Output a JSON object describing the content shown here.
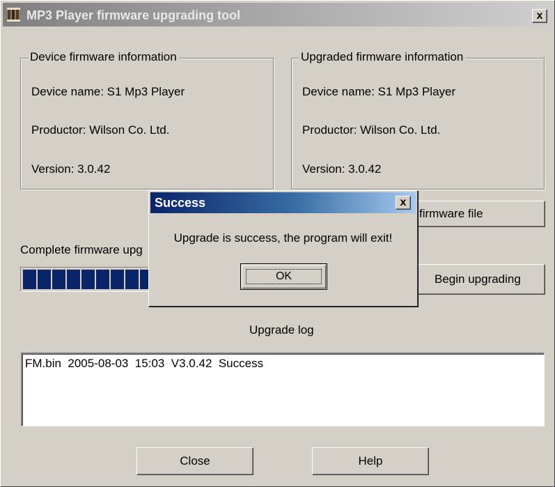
{
  "window": {
    "title": "MP3 Player firmware upgrading tool",
    "close_symbol": "x"
  },
  "device_group": {
    "title": "Device firmware information",
    "device_name": "Device name: S1 Mp3 Player",
    "productor": "Productor: Wilson Co. Ltd.",
    "version": "Version: 3.0.42"
  },
  "upgraded_group": {
    "title": "Upgraded firmware information",
    "device_name": "Device name: S1 Mp3 Player",
    "productor": "Productor: Wilson Co. Ltd.",
    "version": "Version: 3.0.42"
  },
  "buttons": {
    "select_file": "firmware file",
    "begin_upgrading": "Begin upgrading",
    "close": "Close",
    "help": "Help"
  },
  "progress": {
    "label": "Complete firmware upg",
    "filled_segments": 9,
    "color": "#0a246a"
  },
  "log": {
    "title": "Upgrade log",
    "entries": [
      "FM.bin  2005-08-03  15:03  V3.0.42  Success"
    ]
  },
  "dialog": {
    "title": "Success",
    "close_symbol": "x",
    "message": "Upgrade is success, the program will exit!",
    "ok_label": "OK"
  },
  "icons": {
    "app": "app-icon",
    "close": "close-icon"
  }
}
